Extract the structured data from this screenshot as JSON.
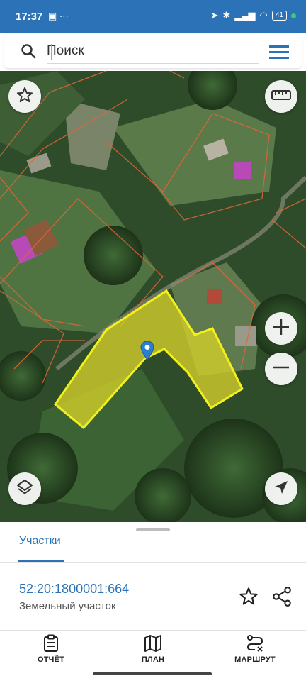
{
  "status_bar": {
    "time": "17:37",
    "battery": "41"
  },
  "search": {
    "placeholder": "Поиск"
  },
  "map": {
    "icons": [
      "star-icon",
      "ruler-icon",
      "layers-icon",
      "zoom-in-icon",
      "zoom-out-icon",
      "my-location-icon",
      "location-pin-icon"
    ]
  },
  "panel": {
    "tab_label": "Участки",
    "cadastral_number": "52:20:1800001:664",
    "parcel_type": "Земельный участок"
  },
  "bottom_nav": {
    "report_label": "ОТЧЁТ",
    "plan_label": "ПЛАН",
    "route_label": "МАРШРУТ"
  },
  "colors": {
    "accent": "#2b73b6",
    "parcel_fill": "#d6d12a",
    "parcel_stroke": "#f2f21a",
    "boundary": "#e0663a"
  }
}
